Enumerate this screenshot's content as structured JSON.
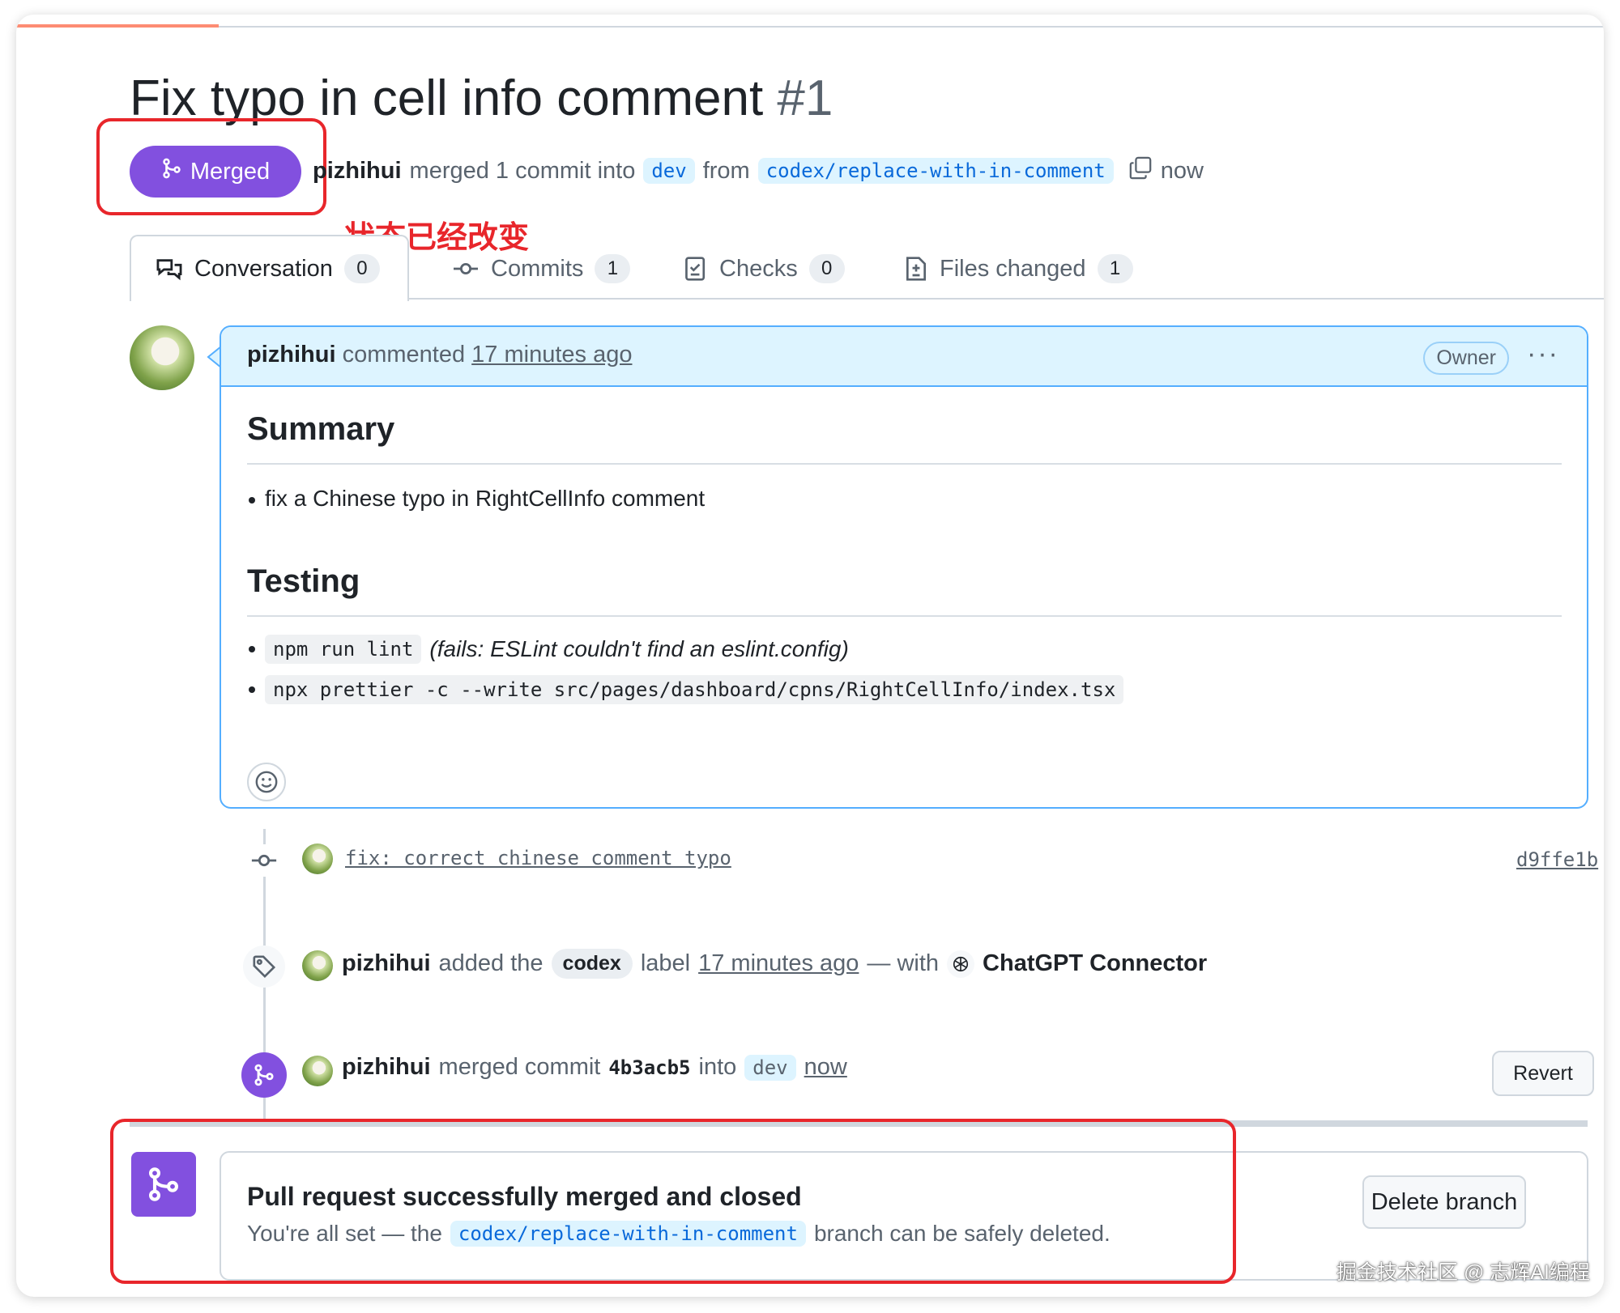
{
  "title": {
    "text": "Fix typo in cell info comment",
    "number": "#1"
  },
  "status": {
    "label": "Merged",
    "color": "#8250df"
  },
  "meta": {
    "author": "pizhihui",
    "action": "merged 1 commit into",
    "base_branch": "dev",
    "from": "from",
    "head_branch": "codex/replace-with-in-comment",
    "time": "now"
  },
  "annotation": "状态已经改变",
  "tabs": [
    {
      "label": "Conversation",
      "count": "0"
    },
    {
      "label": "Commits",
      "count": "1"
    },
    {
      "label": "Checks",
      "count": "0"
    },
    {
      "label": "Files changed",
      "count": "1"
    }
  ],
  "comment": {
    "author": "pizhihui",
    "verb": "commented",
    "time": "17 minutes ago",
    "role": "Owner",
    "menu": "···",
    "summary_heading": "Summary",
    "summary_items": [
      "fix a Chinese typo in RightCellInfo comment"
    ],
    "testing_heading": "Testing",
    "testing_items": [
      {
        "code": "npm run lint",
        "note": "(fails: ESLint couldn't find an eslint.config)"
      },
      {
        "code": "npx prettier -c --write src/pages/dashboard/cpns/RightCellInfo/index.tsx",
        "note": ""
      }
    ]
  },
  "timeline": {
    "commit": {
      "message": "fix: correct chinese comment typo",
      "sha": "d9ffe1b"
    },
    "label_event": {
      "author": "pizhihui",
      "text1": "added the",
      "label": "codex",
      "text2": "label",
      "time": "17 minutes ago",
      "text3": "— with",
      "app": "ChatGPT Connector"
    },
    "merge_event": {
      "author": "pizhihui",
      "text1": "merged commit",
      "sha": "4b3acb5",
      "text2": "into",
      "branch": "dev",
      "time": "now",
      "revert_label": "Revert"
    }
  },
  "merge_box": {
    "title": "Pull request successfully merged and closed",
    "text1": "You're all set — the",
    "branch": "codex/replace-with-in-comment",
    "text2": "branch can be safely deleted.",
    "delete_label": "Delete branch"
  },
  "watermark": "掘金技术社区 @ 志辉AI编程",
  "colors": {
    "accent_purple": "#8250df",
    "link_blue": "#0969da",
    "annotation_red": "#e8262b"
  },
  "icons": [
    "git-merge-icon",
    "copy-icon",
    "conversation-icon",
    "commit-icon",
    "checks-icon",
    "file-diff-icon",
    "kebab-icon",
    "smiley-icon",
    "tag-icon",
    "chatgpt-icon"
  ]
}
